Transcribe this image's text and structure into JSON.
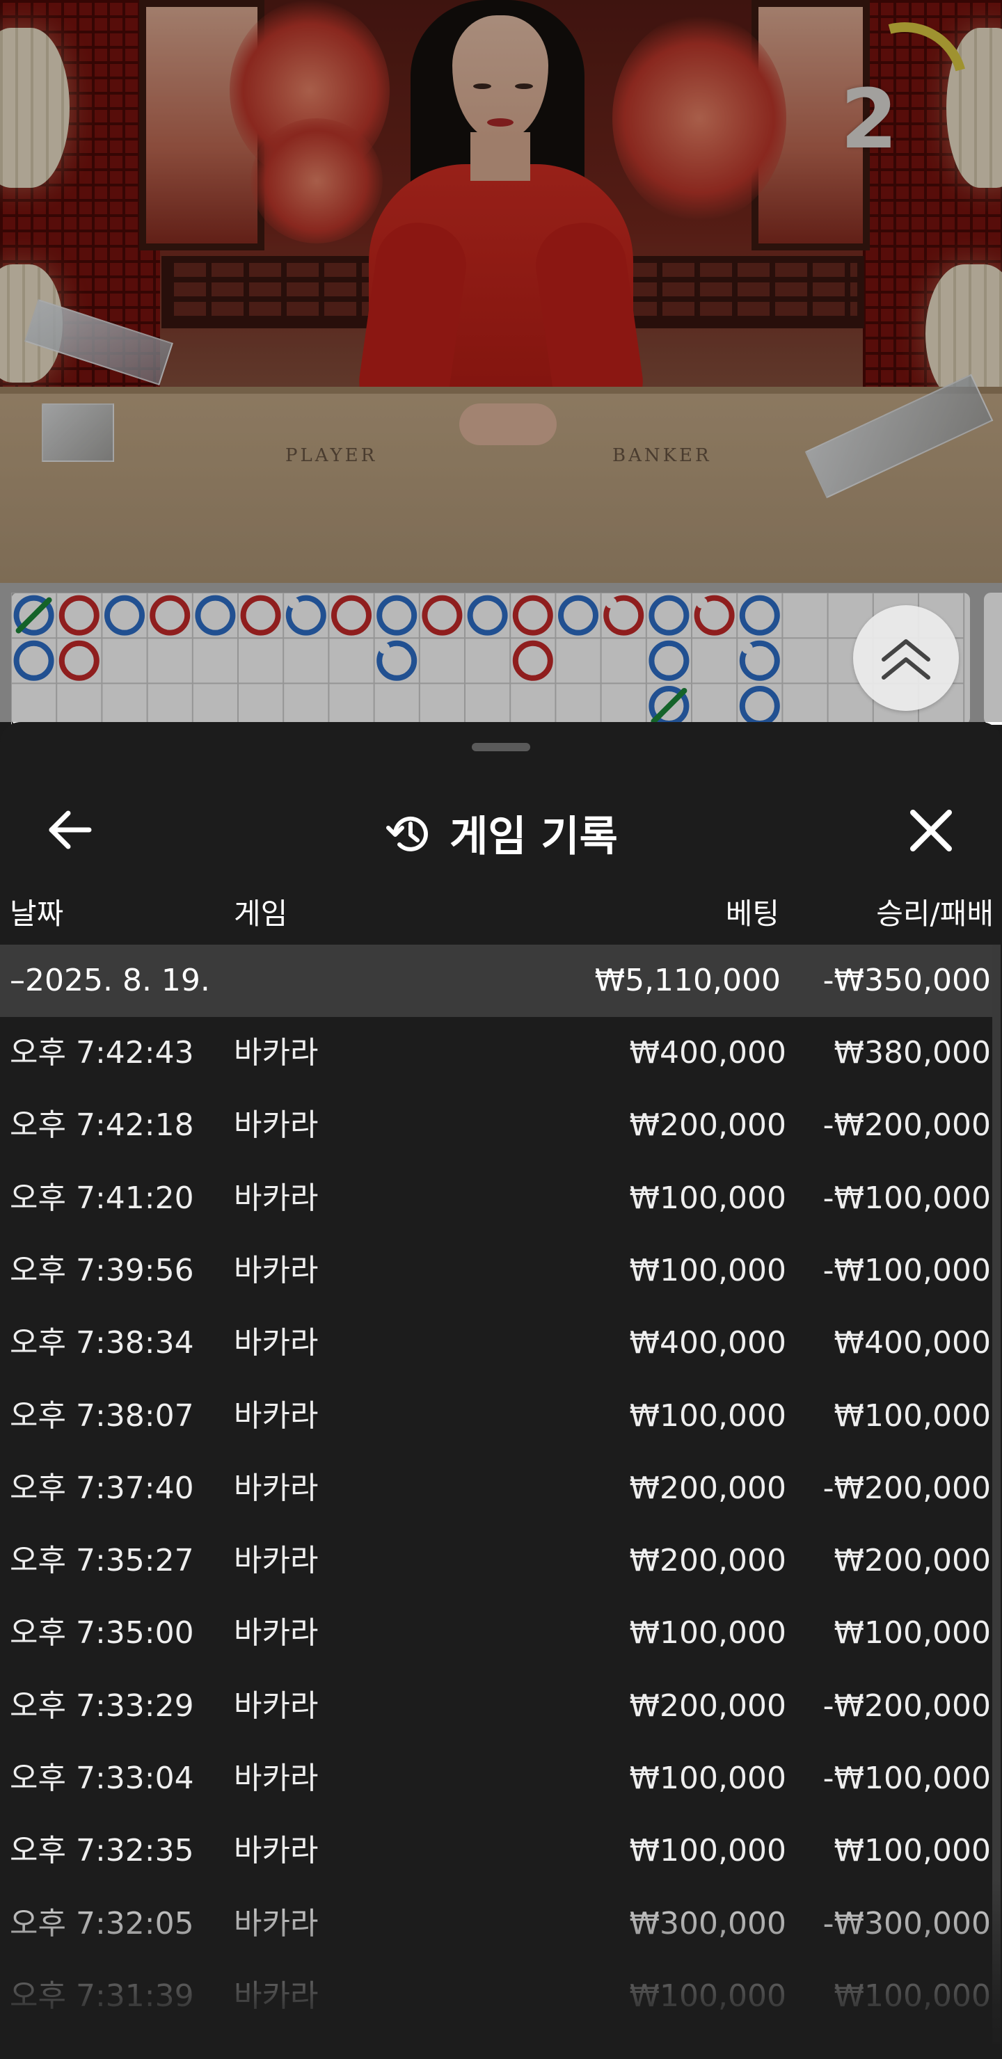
{
  "video": {
    "countdown": "2",
    "table_left": "PLAYER",
    "table_right": "BANKER"
  },
  "roadmap": {
    "colors": {
      "player": "#2f6fc9",
      "banker": "#c62a2a",
      "tie": "#1c8a3a"
    },
    "columns": [
      [
        "P-tie",
        "P"
      ],
      [
        "B",
        "B"
      ],
      [
        "P"
      ],
      [
        "B"
      ],
      [
        "P"
      ],
      [
        "B"
      ],
      [
        "P-pair"
      ],
      [
        "B"
      ],
      [
        "P",
        "P-pair"
      ],
      [
        "B"
      ],
      [
        "P"
      ],
      [
        "B",
        "B"
      ],
      [
        "P"
      ],
      [
        "B-pair"
      ],
      [
        "P",
        "P",
        "P-tie"
      ],
      [
        "B-pair"
      ],
      [
        "P",
        "P-pair",
        "P"
      ]
    ]
  },
  "sheet": {
    "title": "게임 기록",
    "icons": {
      "back": "arrow-left-icon",
      "history": "history-icon",
      "close": "close-icon"
    },
    "columns": {
      "date": "날짜",
      "game": "게임",
      "bet": "베팅",
      "result": "승리/패배"
    },
    "date_group": {
      "label": "–2025. 8. 19.",
      "bet": "₩5,110,000",
      "result": "-₩350,000"
    },
    "rows": [
      {
        "time": "오후 7:42:43",
        "game": "바카라",
        "bet": "₩400,000",
        "result": "₩380,000"
      },
      {
        "time": "오후 7:42:18",
        "game": "바카라",
        "bet": "₩200,000",
        "result": "-₩200,000"
      },
      {
        "time": "오후 7:41:20",
        "game": "바카라",
        "bet": "₩100,000",
        "result": "-₩100,000"
      },
      {
        "time": "오후 7:39:56",
        "game": "바카라",
        "bet": "₩100,000",
        "result": "-₩100,000"
      },
      {
        "time": "오후 7:38:34",
        "game": "바카라",
        "bet": "₩400,000",
        "result": "₩400,000"
      },
      {
        "time": "오후 7:38:07",
        "game": "바카라",
        "bet": "₩100,000",
        "result": "₩100,000"
      },
      {
        "time": "오후 7:37:40",
        "game": "바카라",
        "bet": "₩200,000",
        "result": "-₩200,000"
      },
      {
        "time": "오후 7:35:27",
        "game": "바카라",
        "bet": "₩200,000",
        "result": "₩200,000"
      },
      {
        "time": "오후 7:35:00",
        "game": "바카라",
        "bet": "₩100,000",
        "result": "₩100,000"
      },
      {
        "time": "오후 7:33:29",
        "game": "바카라",
        "bet": "₩200,000",
        "result": "-₩200,000"
      },
      {
        "time": "오후 7:33:04",
        "game": "바카라",
        "bet": "₩100,000",
        "result": "-₩100,000"
      },
      {
        "time": "오후 7:32:35",
        "game": "바카라",
        "bet": "₩100,000",
        "result": "₩100,000"
      },
      {
        "time": "오후 7:32:05",
        "game": "바카라",
        "bet": "₩300,000",
        "result": "-₩300,000"
      },
      {
        "time": "오후 7:31:39",
        "game": "바카라",
        "bet": "₩100,000",
        "result": "₩100,000"
      }
    ]
  }
}
